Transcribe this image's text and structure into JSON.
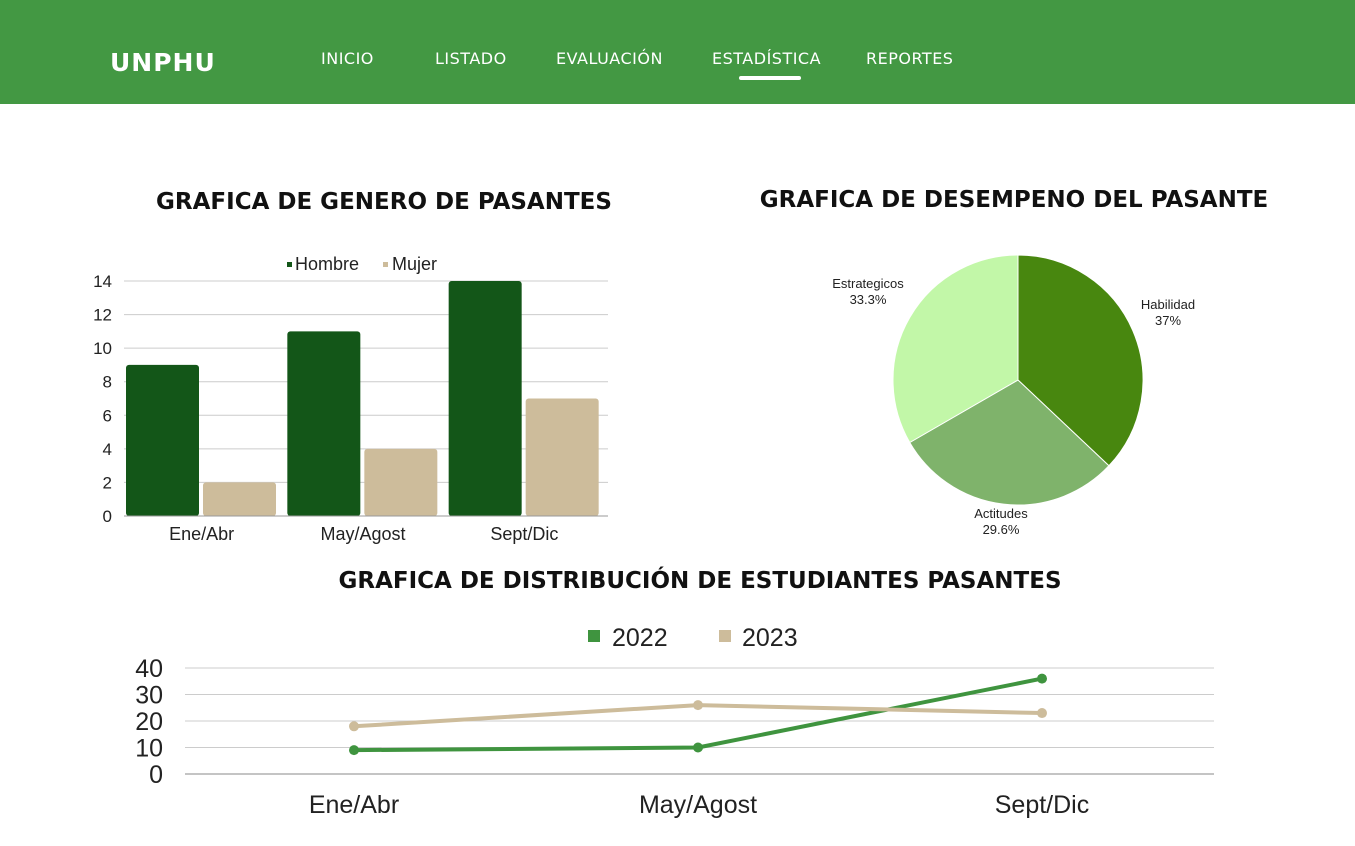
{
  "nav": {
    "brand": "UNPHU",
    "items": [
      {
        "label": "INICIO"
      },
      {
        "label": "LISTADO"
      },
      {
        "label": "EVALUACIÓN"
      },
      {
        "label": "ESTADÍSTICA",
        "active": true
      },
      {
        "label": "REPORTES"
      }
    ]
  },
  "colors": {
    "nav_bg": "#439843",
    "hombre": "#135618",
    "mujer": "#cdbc9b",
    "habilidad": "#48870f",
    "actitudes": "#7fb36b",
    "estrategicos": "#c2f7a8",
    "line_2022": "#3f943f",
    "line_2023": "#cdbc9b"
  },
  "titles": {
    "gender": "GRAFICA DE GENERO DE PASANTES",
    "performance": "GRAFICA DE DESEMPENO DEL PASANTE",
    "distribution": "GRAFICA DE DISTRIBUCIÓN DE ESTUDIANTES PASANTES"
  },
  "chart_data": [
    {
      "type": "bar",
      "title": "GRAFICA DE GENERO DE PASANTES",
      "categories": [
        "Ene/Abr",
        "May/Agost",
        "Sept/Dic"
      ],
      "series": [
        {
          "name": "Hombre",
          "values": [
            9,
            11,
            14
          ]
        },
        {
          "name": "Mujer",
          "values": [
            2,
            4,
            7
          ]
        }
      ],
      "ylim": [
        0,
        14
      ],
      "yticks": [
        0,
        2,
        4,
        6,
        8,
        10,
        12,
        14
      ],
      "grid": true,
      "legend": "top-center"
    },
    {
      "type": "pie",
      "title": "GRAFICA DE DESEMPENO DEL PASANTE",
      "slices": [
        {
          "label": "Habilidad",
          "value": 37,
          "display": "37%"
        },
        {
          "label": "Actitudes",
          "value": 29.6,
          "display": "29.6%"
        },
        {
          "label": "Estrategicos",
          "value": 33.3,
          "display": "33.3%"
        }
      ]
    },
    {
      "type": "line",
      "title": "GRAFICA DE DISTRIBUCIÓN DE ESTUDIANTES PASANTES",
      "categories": [
        "Ene/Abr",
        "May/Agost",
        "Sept/Dic"
      ],
      "series": [
        {
          "name": "2022",
          "values": [
            9,
            10,
            36
          ]
        },
        {
          "name": "2023",
          "values": [
            18,
            26,
            23
          ]
        }
      ],
      "ylim": [
        0,
        40
      ],
      "yticks": [
        0,
        10,
        20,
        30,
        40
      ],
      "grid": true,
      "legend": "top-center"
    }
  ]
}
